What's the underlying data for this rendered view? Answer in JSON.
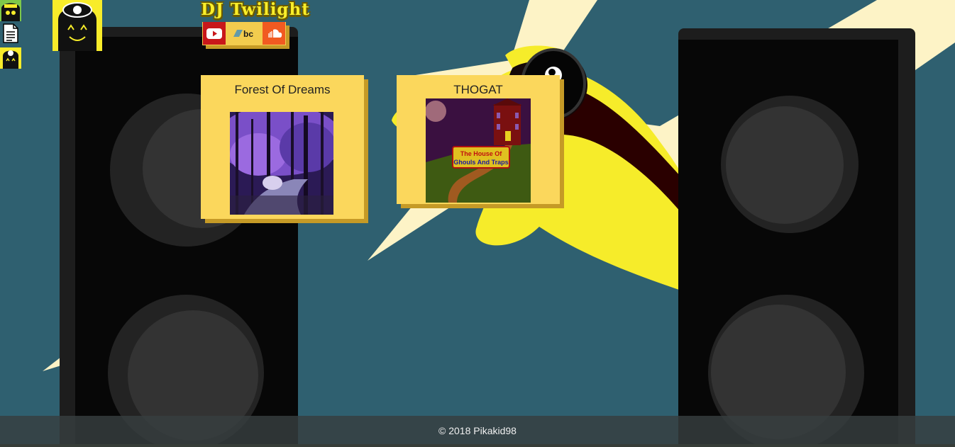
{
  "site": {
    "title": "DJ Twilight"
  },
  "social_links": [
    {
      "name": "YouTube",
      "icon": "youtube-icon",
      "color": "#c8171a"
    },
    {
      "name": "Bandcamp",
      "icon": "bandcamp-icon",
      "label": "bc",
      "color": "#629aa9"
    },
    {
      "name": "SoundCloud",
      "icon": "soundcloud-icon",
      "color": "#f15a21"
    }
  ],
  "albums": [
    {
      "title": "Forest Of Dreams"
    },
    {
      "title": "THOGAT",
      "cover_text": [
        "The House Of",
        "Ghouls And Traps"
      ]
    }
  ],
  "footer": {
    "text": "© 2018 Pikakid98"
  },
  "colors": {
    "background": "#2f6070",
    "card": "#fbd75c",
    "card_shadow": "#c59a26",
    "mascot_yellow": "#f8ec2a",
    "lightning": "#fdf3c6"
  }
}
